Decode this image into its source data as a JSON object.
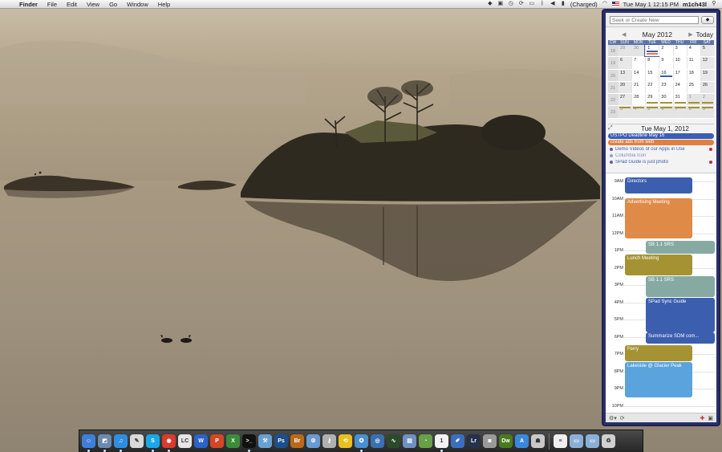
{
  "menubar": {
    "app_name": "Finder",
    "menus": [
      "File",
      "Edit",
      "View",
      "Go",
      "Window",
      "Help"
    ],
    "battery_status": "(Charged)",
    "datetime": "Tue May 1  12:15 PM",
    "username": "m1ch43l",
    "tray_icons": [
      "dropbox-icon",
      "clipboard-icon",
      "time-machine-icon",
      "sync-icon",
      "display-icon",
      "bluetooth-icon",
      "volume-icon"
    ]
  },
  "widget": {
    "search": {
      "placeholder": "Seek or Create New"
    },
    "month_title": "May 2012",
    "today_label": "Today",
    "weekday_headers": [
      "CW",
      "SUN",
      "MON",
      "TUE",
      "WED",
      "THU",
      "FRI",
      "SAT"
    ],
    "weeks": [
      {
        "cw": "18",
        "days": [
          "29",
          "30",
          "1",
          "2",
          "3",
          "4",
          "5"
        ]
      },
      {
        "cw": "19",
        "days": [
          "6",
          "7",
          "8",
          "9",
          "10",
          "11",
          "12"
        ]
      },
      {
        "cw": "20",
        "days": [
          "13",
          "14",
          "15",
          "16",
          "17",
          "18",
          "19"
        ]
      },
      {
        "cw": "21",
        "days": [
          "20",
          "21",
          "22",
          "23",
          "24",
          "25",
          "26"
        ]
      },
      {
        "cw": "22",
        "days": [
          "27",
          "28",
          "29",
          "30",
          "31",
          "1",
          "2"
        ]
      },
      {
        "cw": "23",
        "days": [
          "3",
          "4",
          "5",
          "6",
          "7",
          "8",
          "9"
        ]
      }
    ],
    "day_title": "Tue May 1, 2012",
    "allday_events": [
      {
        "label": "USTPO Deadline May 16",
        "color": "#3a5db8"
      },
      {
        "label": "create ads from web",
        "color": "#e08040"
      }
    ],
    "todos": [
      {
        "label": "Demo Videos of our Apps in Use",
        "flag": true
      },
      {
        "label": "Columbia Icon",
        "flag": false
      },
      {
        "label": "SPad Guide is just photo",
        "flag": true
      }
    ],
    "hours": [
      "9AM",
      "10AM",
      "11AM",
      "12PM",
      "1PM",
      "2PM",
      "3PM",
      "4PM",
      "5PM",
      "6PM",
      "7PM",
      "8PM",
      "9PM",
      "10PM"
    ],
    "events": [
      {
        "label": "Directors",
        "color": "#3b5eaf"
      },
      {
        "label": "Advertising Meeting",
        "color": "#e08a48"
      },
      {
        "label": "SB 1.1 SRS",
        "color": "#86aaa2"
      },
      {
        "label": "Lunch Meeting",
        "color": "#a59233"
      },
      {
        "label": "SB 1.1 SRS",
        "color": "#86aaa2"
      },
      {
        "label": "SPad Sync Guide",
        "color": "#3b5eaf"
      },
      {
        "label": "Summarize SDM com...",
        "color": "#3b5eaf"
      },
      {
        "label": "Ferry",
        "color": "#a59233"
      },
      {
        "label": "Lakeside @ Glacier Peak",
        "color": "#5aa3dc"
      }
    ]
  },
  "dock": {
    "apps": [
      {
        "name": "finder-icon",
        "color": "#3f7fd8",
        "glyph": "☺",
        "running": true
      },
      {
        "name": "preview-icon",
        "color": "#6a8ab0",
        "glyph": "◩",
        "running": true
      },
      {
        "name": "itunes-icon",
        "color": "#2f8ee0",
        "glyph": "♫",
        "running": true
      },
      {
        "name": "textedit-icon",
        "color": "#d8d8d8",
        "glyph": "✎",
        "running": false
      },
      {
        "name": "skype-icon",
        "color": "#1aa7e8",
        "glyph": "S",
        "running": true
      },
      {
        "name": "chrome-icon",
        "color": "#d83b2c",
        "glyph": "◉",
        "running": true
      },
      {
        "name": "lc-icon",
        "color": "#e6e6e6",
        "glyph": "LC",
        "running": false
      },
      {
        "name": "word-icon",
        "color": "#2c63c6",
        "glyph": "W",
        "running": false
      },
      {
        "name": "powerpoint-icon",
        "color": "#d24726",
        "glyph": "P",
        "running": false
      },
      {
        "name": "excel-icon",
        "color": "#3a8c3a",
        "glyph": "X",
        "running": false
      },
      {
        "name": "terminal-icon",
        "color": "#111111",
        "glyph": ">_",
        "running": true
      },
      {
        "name": "xcode-icon",
        "color": "#6aa0d0",
        "glyph": "⚒",
        "running": false
      },
      {
        "name": "photoshop-icon",
        "color": "#1d4f8c",
        "glyph": "Ps",
        "running": false
      },
      {
        "name": "bridge-icon",
        "color": "#b86a1a",
        "glyph": "Br",
        "running": false
      },
      {
        "name": "folder-utils-icon",
        "color": "#6a9ad0",
        "glyph": "⚙",
        "running": false
      },
      {
        "name": "keychain-icon",
        "color": "#b0b0b0",
        "glyph": "⚷",
        "running": false
      },
      {
        "name": "timeline-icon",
        "color": "#e8c020",
        "glyph": "⟲",
        "running": false
      },
      {
        "name": "safari-icon",
        "color": "#4a90d0",
        "glyph": "✪",
        "running": true
      },
      {
        "name": "network-icon",
        "color": "#3a70b0",
        "glyph": "◎",
        "running": false
      },
      {
        "name": "activity-monitor-icon",
        "color": "#2a4a2a",
        "glyph": "∿",
        "running": false
      },
      {
        "name": "remote-desktop-icon",
        "color": "#7090c0",
        "glyph": "▤",
        "running": false
      },
      {
        "name": "stats-icon",
        "color": "#68a048",
        "glyph": "◔",
        "running": false
      },
      {
        "name": "ical-icon",
        "color": "#f2f2f2",
        "glyph": "1",
        "running": true
      },
      {
        "name": "pages-icon",
        "color": "#3a6fc0",
        "glyph": "✐",
        "running": false
      },
      {
        "name": "lightroom-icon",
        "color": "#25324a",
        "glyph": "Lr",
        "running": false
      },
      {
        "name": "screenshot-icon",
        "color": "#9a9a9a",
        "glyph": "◙",
        "running": false
      },
      {
        "name": "dreamweaver-icon",
        "color": "#4a7a20",
        "glyph": "Dw",
        "running": false
      },
      {
        "name": "app-store-icon",
        "color": "#3a88d8",
        "glyph": "A",
        "running": false
      },
      {
        "name": "automator-icon",
        "color": "#c8c8c8",
        "glyph": "☗",
        "running": false
      }
    ],
    "stacks": [
      {
        "name": "document-stack-icon",
        "color": "#f0f0f0",
        "glyph": "≡"
      },
      {
        "name": "applications-folder-icon",
        "color": "#8ab0d8",
        "glyph": "▭"
      },
      {
        "name": "downloads-folder-icon",
        "color": "#8ab0d8",
        "glyph": "▭"
      },
      {
        "name": "trash-icon",
        "color": "#cfcfcf",
        "glyph": "♻"
      }
    ]
  }
}
